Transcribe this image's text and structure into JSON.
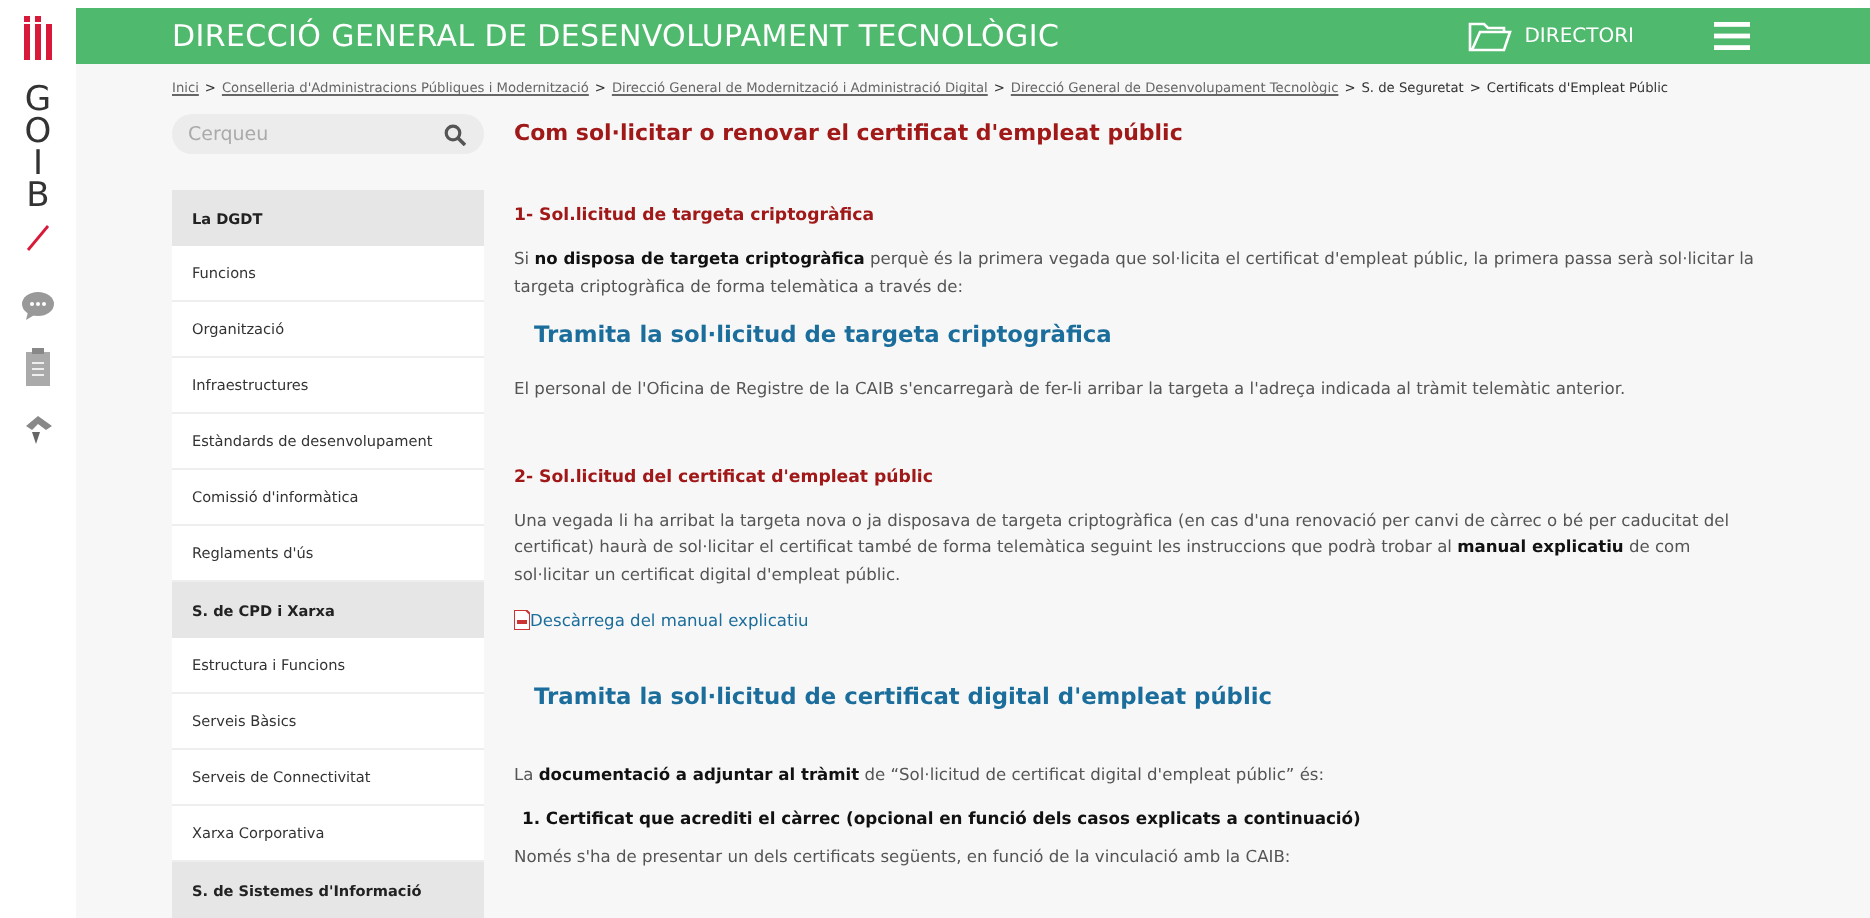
{
  "header": {
    "title": "DIRECCIÓ GENERAL DE DESENVOLUPAMENT TECNOLÒGIC",
    "directory_button": "DIRECTORI"
  },
  "brand": {
    "letters": [
      "G",
      "O",
      "I",
      "B"
    ]
  },
  "breadcrumb_separator": ">",
  "breadcrumb": [
    {
      "label": "Inici",
      "kind": "link"
    },
    {
      "label": "Conselleria d'Administracions Públiques i Modernització",
      "kind": "link"
    },
    {
      "label": "Direcció General de Modernització i Administració Digital",
      "kind": "link"
    },
    {
      "label": "Direcció General de Desenvolupament Tecnològic",
      "kind": "link"
    },
    {
      "label": "S. de Seguretat",
      "kind": "text"
    },
    {
      "label": "Certificats d'Empleat Públic",
      "kind": "text"
    }
  ],
  "search": {
    "placeholder": "Cerqueu"
  },
  "sidebar": {
    "sections": [
      {
        "title": "La DGDT",
        "items": [
          "Funcions",
          "Organització",
          "Infraestructures",
          "Estàndards de desenvolupament",
          "Comissió d'informàtica",
          "Reglaments d'ús"
        ]
      },
      {
        "title": "S. de CPD i Xarxa",
        "items": [
          "Estructura i Funcions",
          "Serveis Bàsics",
          "Serveis de Connectivitat",
          "Xarxa Corporativa"
        ]
      },
      {
        "title": "S. de Sistemes d'Informació"
      }
    ]
  },
  "content": {
    "title": "Com sol·licitar o renovar el certificat d'empleat públic",
    "blocks": [
      {
        "kind": "heading",
        "text": "1- Sol.licitud de targeta criptogràfica"
      },
      {
        "kind": "paragraph",
        "text": "Si **no disposa de targeta criptogràfica** perquè és la primera vegada que sol·licita el certificat d'empleat públic, la primera passa serà sol·licitar la targeta criptogràfica de forma telemàtica a través de:"
      },
      {
        "kind": "action",
        "text": "Tramita la sol·licitud de targeta criptogràfica"
      },
      {
        "kind": "paragraph",
        "text": "El personal de l'Oficina de Registre de la CAIB s'encarregarà de fer-li arribar la targeta a l'adreça indicada al tràmit telemàtic anterior."
      },
      {
        "kind": "heading",
        "text": "2- Sol.licitud del certificat d'empleat públic"
      },
      {
        "kind": "paragraph",
        "text": "Una vegada li ha arribat la targeta nova o ja disposava de targeta criptogràfica (en cas d'una renovació per canvi de càrrec o bé per caducitat del certificat) haurà de sol·licitar el certificat també de forma telemàtica seguint les instruccions que podrà trobar al **manual explicatiu** de com sol·licitar un certificat digital d'empleat públic."
      },
      {
        "kind": "download",
        "text": "Descàrrega del manual explicatiu"
      },
      {
        "kind": "action",
        "text": "Tramita la sol·licitud de certificat digital d'empleat públic"
      },
      {
        "kind": "paragraph",
        "text": "La **documentació a adjuntar al tràmit** de “Sol·licitud de certificat digital d'empleat públic” és:"
      },
      {
        "kind": "subheading",
        "text": "1. Certificat que acrediti el càrrec (opcional en funció dels casos explicats a continuació)"
      },
      {
        "kind": "paragraph",
        "text": "Només s'ha de presentar un dels certificats següents, en funció de la vinculació amb la CAIB:"
      }
    ]
  }
}
